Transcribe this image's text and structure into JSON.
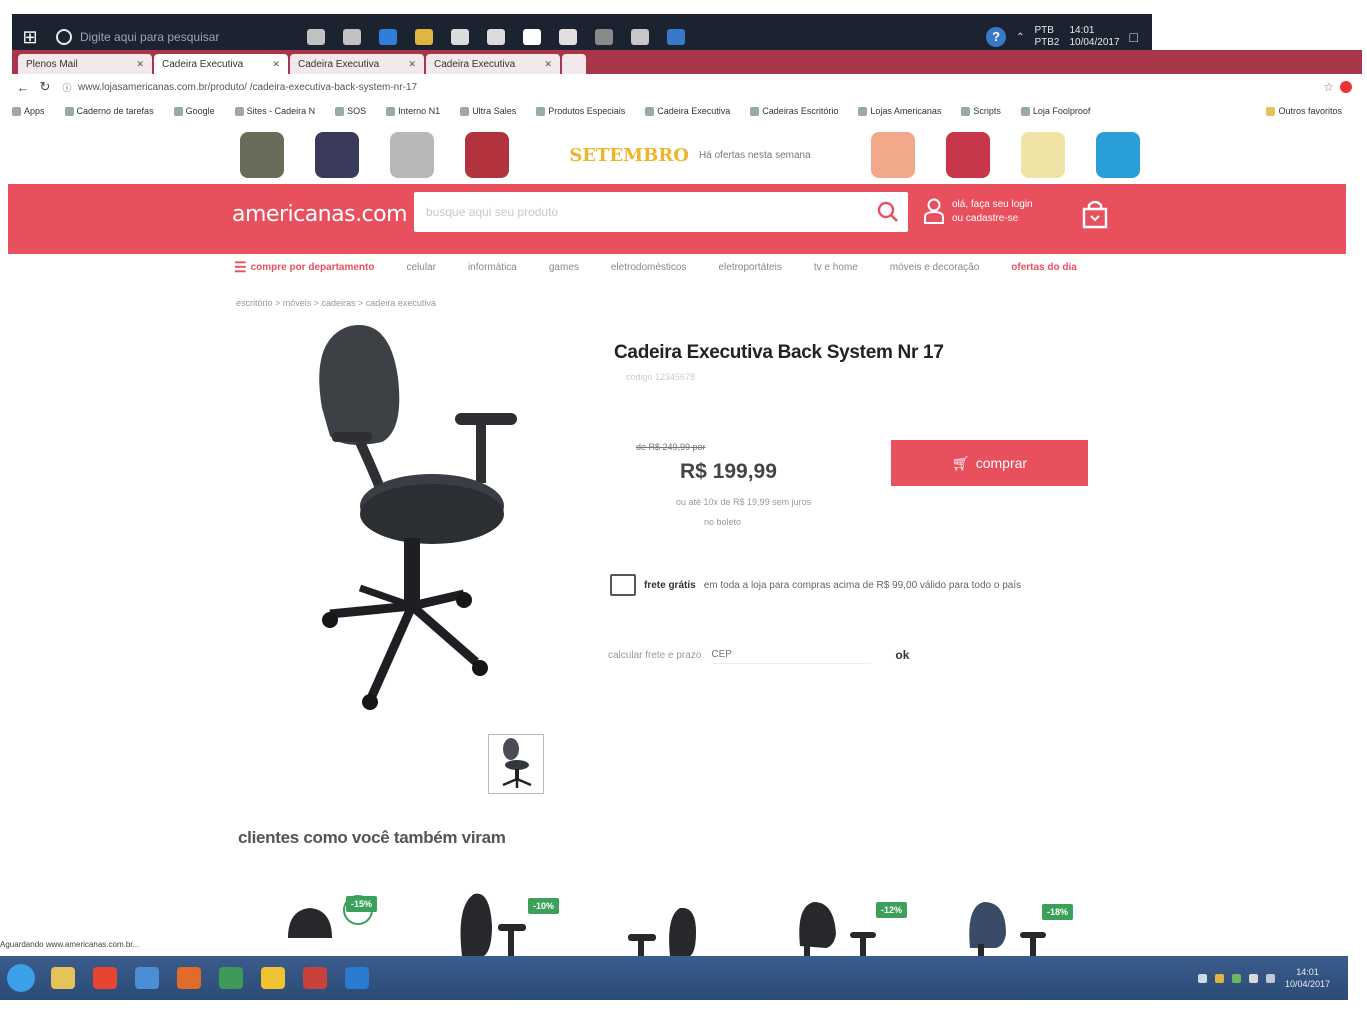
{
  "os_taskbar": {
    "search_placeholder": "Digite aqui para pesquisar",
    "tray_lines": [
      "PTB",
      "14:01",
      "PTB2",
      "10/04/2017"
    ],
    "app_colors": [
      "#c1c1c1",
      "#c1c1c1",
      "#2f7fd8",
      "#e0b640",
      "#dcdcdc",
      "#dcdcdc",
      "#ffffff",
      "#e0e0e0",
      "#8a8a8a",
      "#c8c8c8",
      "#3a78c8"
    ]
  },
  "browser": {
    "tabs": [
      {
        "label": "Plenos Mail",
        "active": false
      },
      {
        "label": "Cadeira Executiva",
        "active": true
      },
      {
        "label": "Cadeira Executiva",
        "active": false
      },
      {
        "label": "Cadeira Executiva",
        "active": false
      }
    ],
    "url": "www.lojasamericanas.com.br/produto/ /cadeira-executiva-back-system-nr-17",
    "bookmarks": [
      "Apps",
      "Caderno de tarefas",
      "Google",
      "Sites - Cadeira N",
      "SOS",
      "Interno N1",
      "Ultra Sales",
      "Produtos Especiais",
      "Cadeira Executiva",
      "Cadeiras Escritório",
      "Lojas Americanas",
      "Scripts",
      "Loja Foolproof"
    ],
    "other_bookmarks": "Outros favoritos"
  },
  "promo": {
    "logo": "SETEMBRO",
    "text": "Há ofertas nesta semana",
    "figure_colors": [
      "#6b6b5a",
      "#3a3a5a",
      "#b8b8b8",
      "#b2333d",
      "#f2a88a",
      "#c8364a",
      "#efe4a6",
      "#2a9ed6"
    ]
  },
  "header": {
    "logo": "americanas.com",
    "search_placeholder": "busque aqui seu produto",
    "account_line1": "olá, faça seu login",
    "account_line2": "ou cadastre-se"
  },
  "categories": {
    "main": "compre por departamento",
    "items": [
      "celular",
      "informática",
      "games",
      "eletrodomésticos",
      "eletroportáteis",
      "tv e home",
      "móveis e decoração"
    ],
    "offer": "ofertas do dia"
  },
  "breadcrumb": "escritório > móveis > cadeiras > cadeira executiva",
  "product": {
    "title": "Cadeira Executiva Back System Nr 17",
    "sku": "código 12345678",
    "old_price": "de R$ 249,99 por",
    "price": "R$ 199,99",
    "installments": "ou até 10x de R$ 19,99 sem juros",
    "cash_note": "no boleto",
    "buy_label": "comprar",
    "shipping_bold": "frete grátis",
    "shipping_text": "em toda a loja para compras acima de R$ 99,00 válido para todo o país",
    "zip_label": "calcular frete e prazo",
    "zip_placeholder": "CEP",
    "zip_ok": "ok"
  },
  "related": {
    "title": "clientes como você também viram",
    "badges": [
      "-15%",
      "-10%",
      "-12%",
      "-18%"
    ]
  },
  "status_text": "Aguardando www.americanas.com.br...",
  "bottom_taskbar": {
    "app_colors": [
      "#3aa0e8",
      "#e6c35a",
      "#e8442f",
      "#4a8ed6",
      "#e26b2c",
      "#3d9a5a",
      "#f1c232",
      "#c9413a",
      "#2a7ad0"
    ],
    "time": "14:01",
    "date": "10/04/2017",
    "tray_colors": [
      "#cfd8e6",
      "#e0b640",
      "#68b860",
      "#d8d8d8",
      "#c0c8d6"
    ]
  },
  "colors": {
    "brand_red": "#e8505e",
    "discount_green": "#3aa05a"
  }
}
